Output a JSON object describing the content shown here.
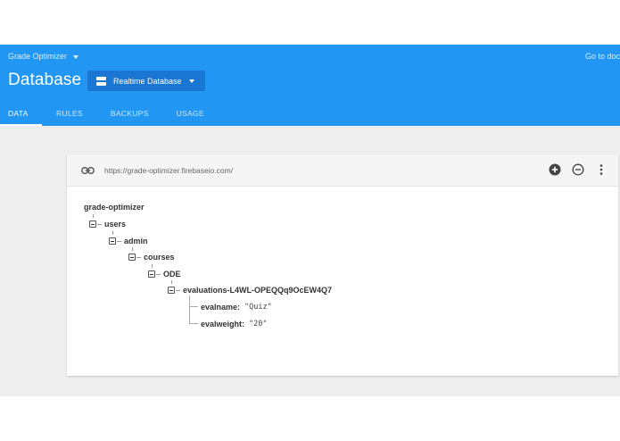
{
  "header": {
    "project_name": "Grade Optimizer",
    "goto_docs": "Go to doc",
    "title": "Database",
    "db_type": "Realtime Database",
    "tabs": [
      {
        "label": "DATA",
        "active": true
      },
      {
        "label": "RULES",
        "active": false
      },
      {
        "label": "BACKUPS",
        "active": false
      },
      {
        "label": "USAGE",
        "active": false
      }
    ],
    "accent_color": "#2196F3"
  },
  "card": {
    "url": "https://grade-optimizer.firebaseio.com/",
    "icons": [
      "link-icon",
      "add-circle-icon",
      "remove-circle-icon",
      "more-vert-icon"
    ]
  },
  "tree": {
    "root": "grade-optimizer",
    "nodes": [
      "users",
      "admin",
      "courses",
      "ODE",
      "evaluations-L4WL-OPEQQq9OcEW4Q7"
    ],
    "leaves": [
      {
        "key": "evalname:",
        "value": "\"Quiz\""
      },
      {
        "key": "evalweight:",
        "value": "\"20\""
      }
    ]
  }
}
